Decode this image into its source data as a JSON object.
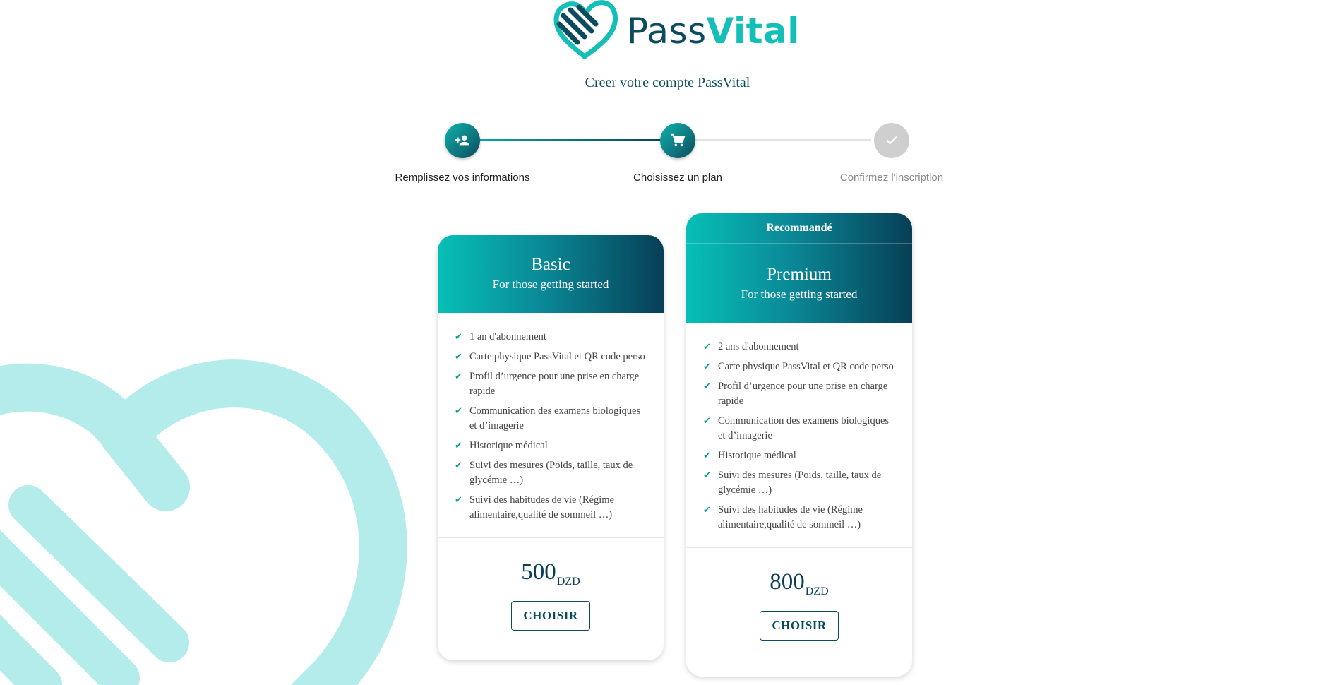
{
  "brand": {
    "name_part1": "Pass",
    "name_part2": "Vital",
    "colors": {
      "primary_teal": "#14bfb8",
      "dark_teal": "#0b4b5e",
      "decoration": "#b3ecea"
    }
  },
  "page": {
    "subtitle": "Creer votre compte PassVital"
  },
  "stepper": {
    "steps": [
      {
        "label": "Remplissez vos informations",
        "icon": "person-add-icon",
        "status": "completed"
      },
      {
        "label": "Choisissez un plan",
        "icon": "shopping-cart-icon",
        "status": "active"
      },
      {
        "label": "Confirmez l'inscription",
        "icon": "check-icon",
        "status": "pending"
      }
    ]
  },
  "plans": [
    {
      "name": "Basic",
      "tagline": "For those getting started",
      "recommended": false,
      "features": [
        "1 an d'abonnement",
        "Carte physique PassVital et QR code perso",
        "Profil d’urgence pour une prise en charge rapide",
        "Communication des examens biologiques et d’imagerie",
        "Historique médical",
        "Suivi des mesures (Poids, taille, taux de glycémie …)",
        "Suivi des habitudes de vie (Régime alimentaire,qualité de sommeil …)"
      ],
      "price": "500",
      "currency": "DZD",
      "button_label": "CHOISIR"
    },
    {
      "name": "Premium",
      "tagline": "For those getting started",
      "recommended": true,
      "badge": "Recommandé",
      "features": [
        "2 ans d'abonnement",
        "Carte physique PassVital et QR code perso",
        "Profil d’urgence pour une prise en charge rapide",
        "Communication des examens biologiques et d’imagerie",
        "Historique médical",
        "Suivi des mesures (Poids, taille, taux de glycémie …)",
        "Suivi des habitudes de vie (Régime alimentaire,qualité de sommeil …)"
      ],
      "price": "800",
      "currency": "DZD",
      "button_label": "CHOISIR"
    }
  ]
}
